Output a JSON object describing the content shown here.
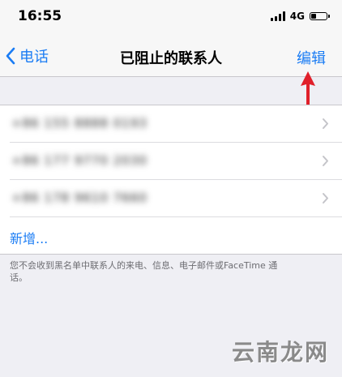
{
  "status_bar": {
    "time": "16:55",
    "network": "4G"
  },
  "nav": {
    "back_label": "电话",
    "title": "已阻止的联系人",
    "edit_label": "编辑"
  },
  "blocked_list": {
    "rows": [
      {
        "number": "+86 155 8888 0193"
      },
      {
        "number": "+86 177 9770 2030"
      },
      {
        "number": "+86 178 9610 7660"
      }
    ],
    "add_label": "新增..."
  },
  "footer_note": "您不会收到黑名单中联系人的来电、信息、电子邮件或FaceTime 通话。",
  "watermark": "云南龙网",
  "colors": {
    "accent": "#1a7cf4",
    "annotation_arrow": "#e0202a"
  },
  "battery_level": 0.3
}
